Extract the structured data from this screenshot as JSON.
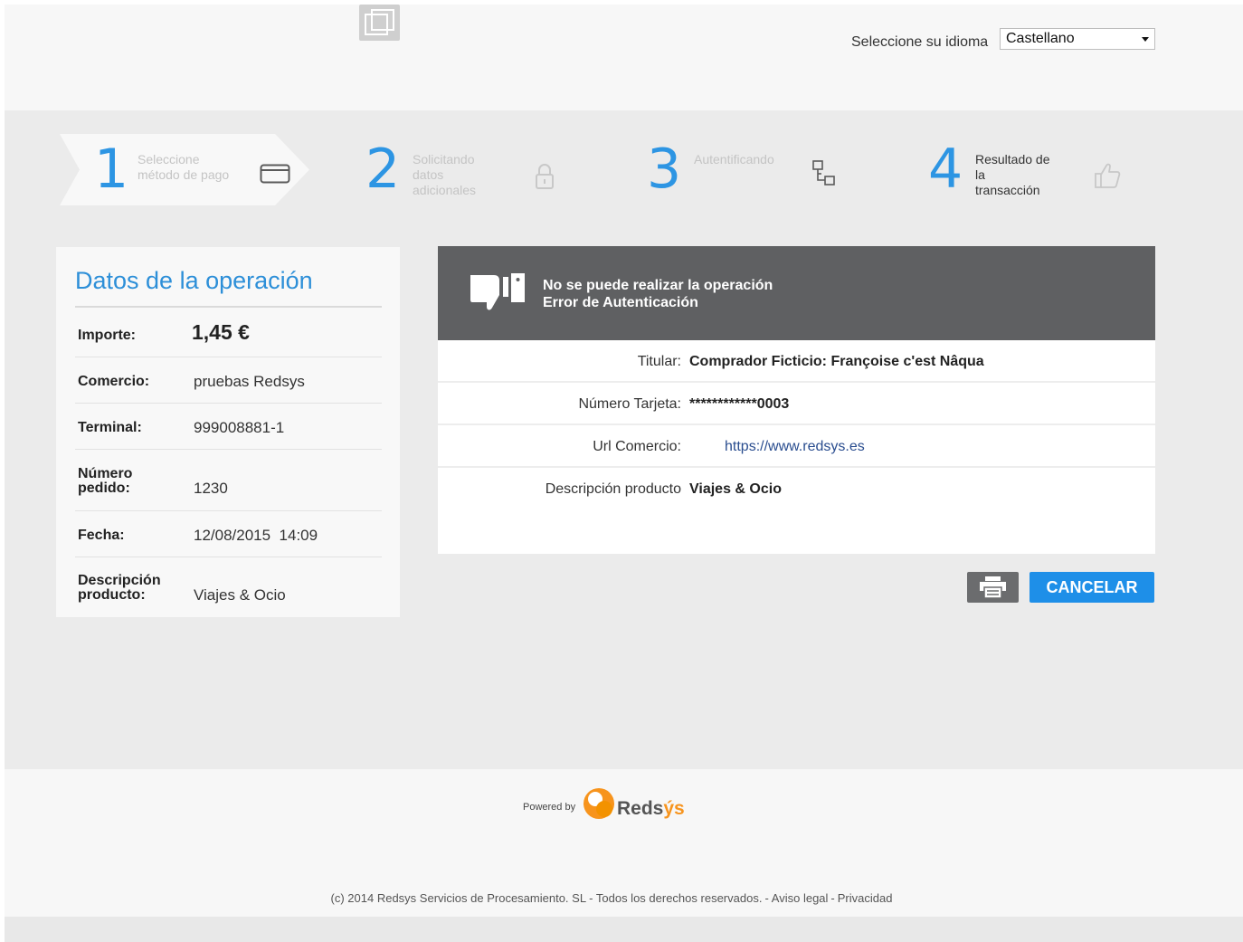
{
  "header": {
    "language_label": "Seleccione su idioma",
    "language_selected": "Castellano"
  },
  "steps": [
    {
      "number": "1",
      "label": "Seleccione método de pago",
      "line1": "Seleccione",
      "line2": "método de pago",
      "icon": "card-icon"
    },
    {
      "number": "2",
      "label": "Solicitando datos adicionales",
      "line1": "Solicitando",
      "line2": "datos",
      "line3": "adicionales",
      "icon": "lock-icon"
    },
    {
      "number": "3",
      "label": "Autentificando",
      "line1": "Autentificando",
      "icon": "network-icon"
    },
    {
      "number": "4",
      "label": "Resultado de la transacción",
      "line1": "Resultado de",
      "line2": "la",
      "line3": "transacción",
      "icon": "thumbs-up-icon"
    }
  ],
  "operation": {
    "title": "Datos de la operación",
    "rows": [
      {
        "label": "Importe:",
        "value": "1,45 €"
      },
      {
        "label": "Comercio:",
        "value": "pruebas Redsys"
      },
      {
        "label": "Terminal:",
        "value": "999008881-1"
      },
      {
        "label": "Número pedido:",
        "label1": "Número",
        "label2": "pedido:",
        "value": "1230"
      },
      {
        "label": "Fecha:",
        "value": "12/08/2015  14:09"
      },
      {
        "label": "Descripción producto:",
        "label1": "Descripción",
        "label2": "producto:",
        "value": "Viajes & Ocio"
      }
    ]
  },
  "result": {
    "message_line1": "No se puede realizar la operación",
    "message_line2": "Error de Autenticación",
    "details": [
      {
        "label": "Titular:",
        "value": "Comprador Ficticio: Françoise c'est Nâqua"
      },
      {
        "label": "Número Tarjeta:",
        "value": "************0003"
      },
      {
        "label": "Url Comercio:",
        "value": "https://www.redsys.es"
      },
      {
        "label": "Descripción producto",
        "value": "Viajes & Ocio"
      }
    ]
  },
  "actions": {
    "print_icon": "printer-icon",
    "cancel_label": "CANCELAR"
  },
  "footer": {
    "powered_by": "Powered by",
    "brand_main": "Reds",
    "brand_accent": "ýs",
    "copyright": "(c) 2014 Redsys Servicios de Procesamiento. SL - Todos los derechos reservados.",
    "legal_link": "Aviso legal",
    "privacy_link": "Privacidad"
  },
  "colors": {
    "accent_blue": "#2d95e3",
    "button_blue": "#1e8fe8",
    "header_gray": "#5f6062",
    "brand_orange": "#f7941d"
  }
}
